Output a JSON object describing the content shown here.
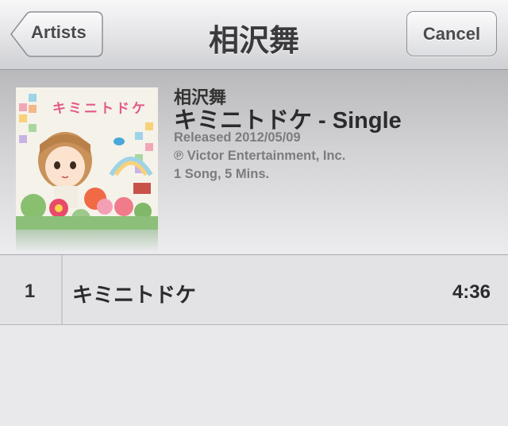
{
  "nav": {
    "title": "相沢舞",
    "back_label": "Artists",
    "cancel_label": "Cancel"
  },
  "album": {
    "artist": "相沢舞",
    "title": "キミニトドケ - Single",
    "released": "Released 2012/05/09",
    "copyright": "℗ Victor Entertainment, Inc.",
    "summary": "1 Song, 5 Mins.",
    "artwork_text": "キミニトドケ",
    "artwork_icon": "album-artwork-illustration"
  },
  "tracks": [
    {
      "number": "1",
      "name": "キミニトドケ",
      "duration": "4:36"
    }
  ],
  "colors": {
    "background": "#e9e9ec",
    "nav_text": "#3a3a3d",
    "meta_text": "#7c7c80"
  }
}
